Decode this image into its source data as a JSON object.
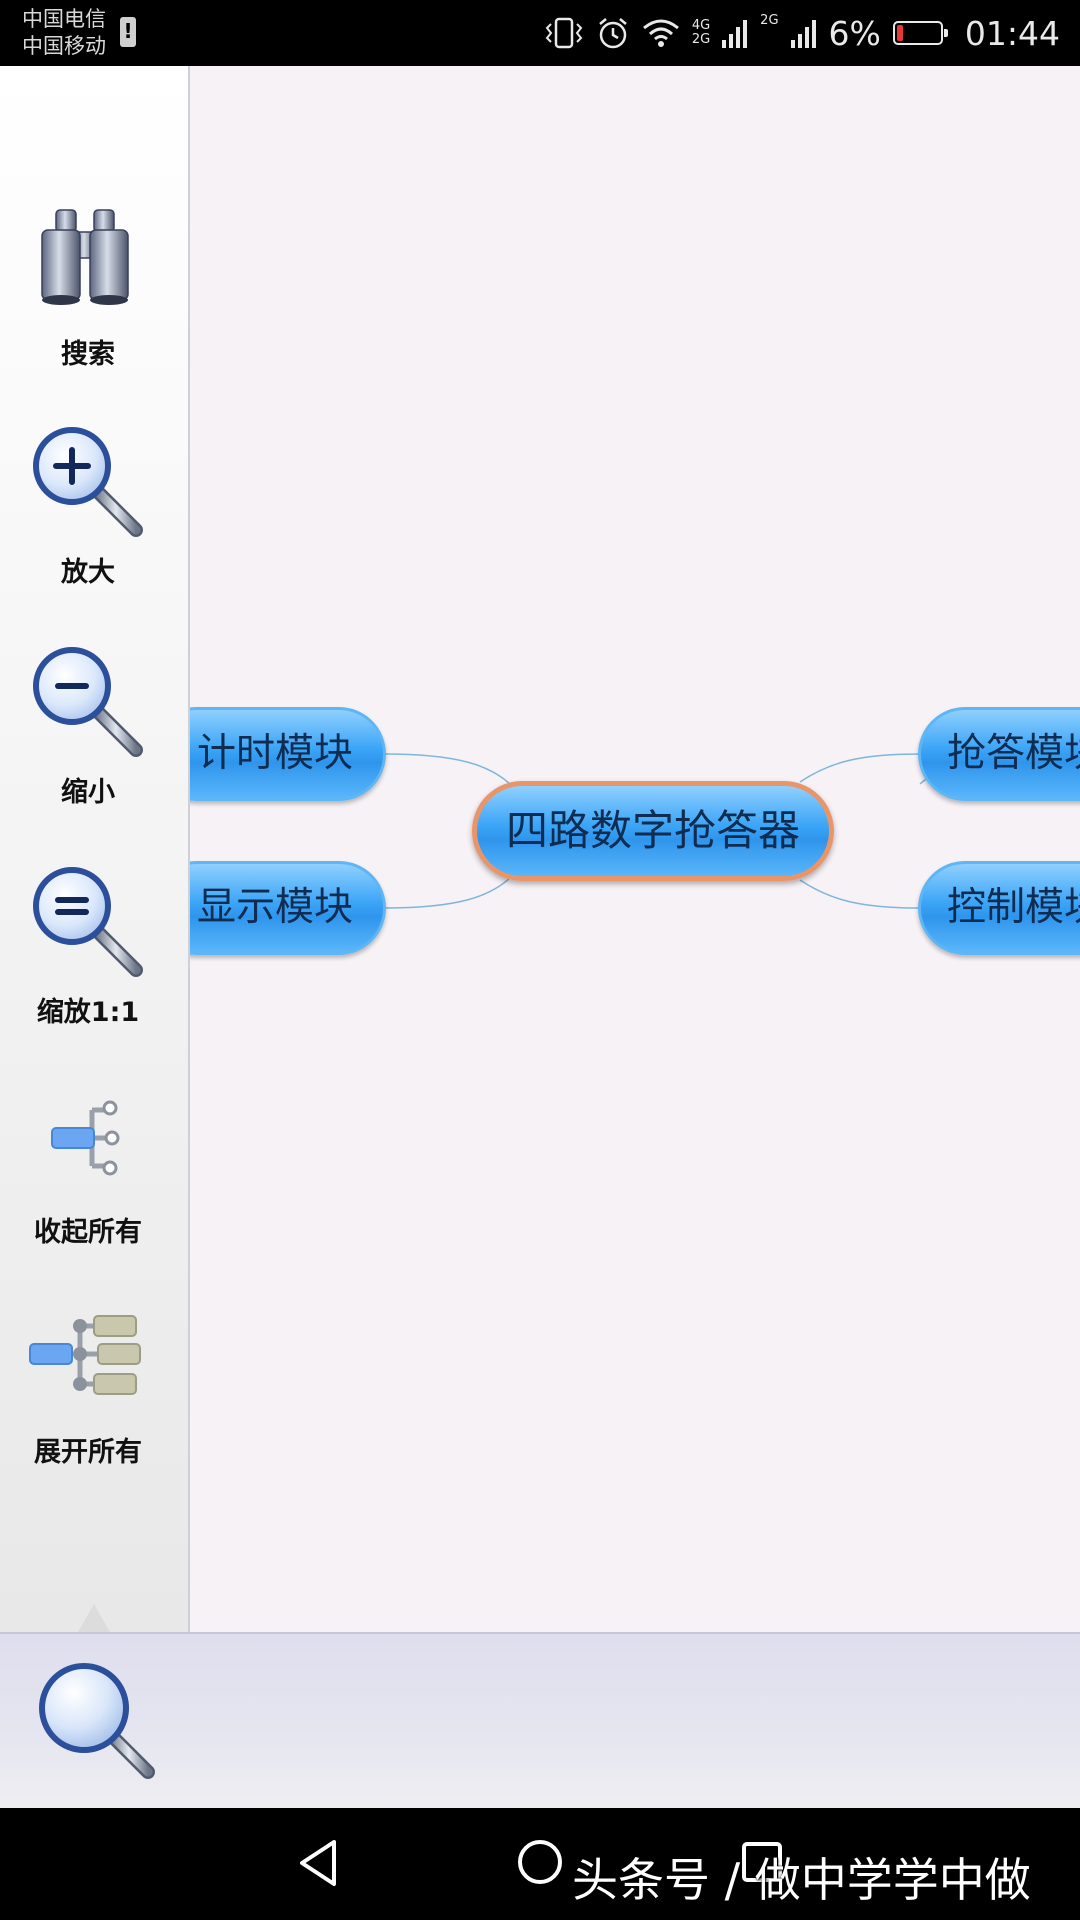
{
  "status_bar": {
    "carrier_1": "中国电信",
    "carrier_2": "中国移动",
    "sim_alert": "!",
    "net_1_top": "4G",
    "net_1_bottom": "2G",
    "net_2": "2G",
    "battery_percent": "6%",
    "time": "01:44"
  },
  "toolbar": {
    "search_label": "搜索",
    "zoom_in_label": "放大",
    "zoom_out_label": "缩小",
    "zoom_reset_label": "缩放1:1",
    "collapse_all_label": "收起所有",
    "expand_all_label": "展开所有"
  },
  "mindmap": {
    "root": "四路数字抢答器",
    "left_nodes": [
      "计时模块",
      "显示模块"
    ],
    "right_nodes": [
      "抢答模块",
      "控制模块"
    ]
  },
  "watermark": "头条号 / 做中学学中做",
  "colors": {
    "node_fill": "#3aa4f6",
    "root_border": "#e9956a",
    "connector": "#7fb6d9",
    "battery_low": "#e53935"
  },
  "icons": {
    "search": "binoculars-icon",
    "zoom_in": "zoom-in-icon",
    "zoom_out": "zoom-out-icon",
    "zoom_reset": "zoom-reset-icon",
    "collapse_all": "collapse-tree-icon",
    "expand_all": "expand-tree-icon",
    "find": "magnifier-icon"
  }
}
